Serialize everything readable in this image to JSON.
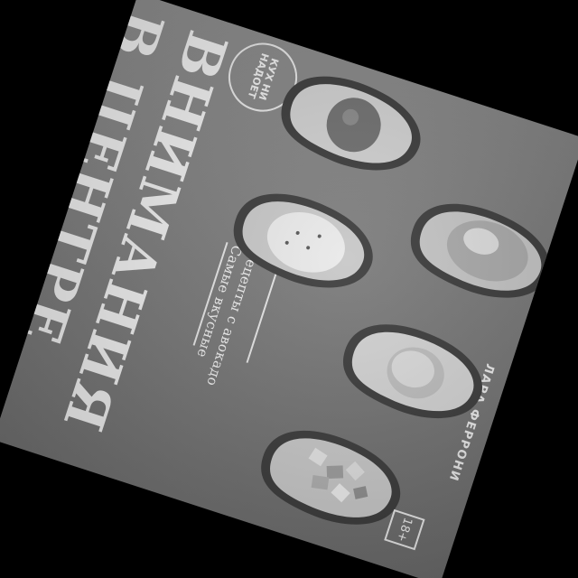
{
  "cover": {
    "title_line_1": "В ЦЕНТРЕ",
    "title_line_2": "ВНИМАНИЯ",
    "subtitle_line_1": "Самые вкусные",
    "subtitle_line_2": "рецепты с авокадо",
    "author": "ЛАРА ФЕРРОНИ",
    "badge": "КУХ НИ НАДОЕТ",
    "age_rating": "18+"
  }
}
